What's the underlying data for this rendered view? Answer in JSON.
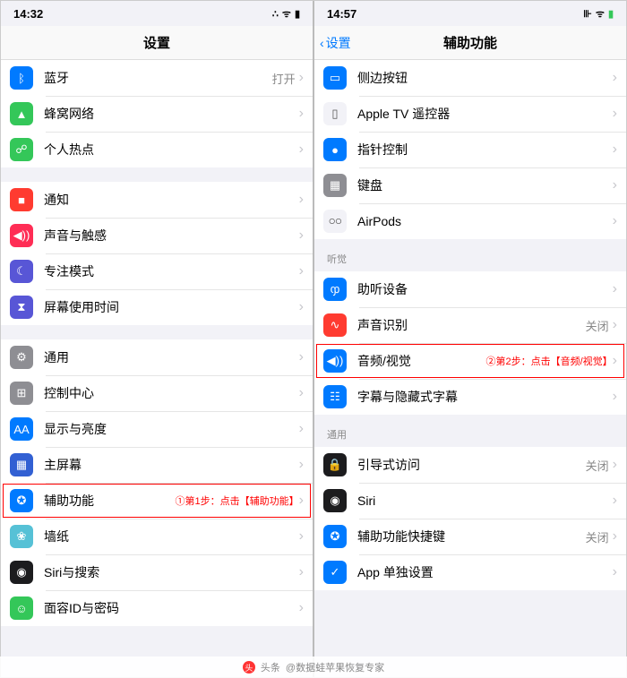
{
  "left": {
    "status": {
      "time": "14:32",
      "signal": "▪▪▪▪",
      "wifi": "✓",
      "battery": "■"
    },
    "title": "设置",
    "groups": [
      {
        "rows": [
          {
            "icon": "bluetooth",
            "bg": "#007aff",
            "label": "蓝牙",
            "value": "打开"
          },
          {
            "icon": "cellular",
            "bg": "#34c759",
            "label": "蜂窝网络",
            "value": ""
          },
          {
            "icon": "hotspot",
            "bg": "#34c759",
            "label": "个人热点",
            "value": ""
          }
        ]
      },
      {
        "rows": [
          {
            "icon": "notify",
            "bg": "#ff3b30",
            "label": "通知",
            "value": ""
          },
          {
            "icon": "sound",
            "bg": "#ff2d55",
            "label": "声音与触感",
            "value": ""
          },
          {
            "icon": "focus",
            "bg": "#5856d6",
            "label": "专注模式",
            "value": ""
          },
          {
            "icon": "screentime",
            "bg": "#5856d6",
            "label": "屏幕使用时间",
            "value": ""
          }
        ]
      },
      {
        "rows": [
          {
            "icon": "general",
            "bg": "#8e8e93",
            "label": "通用",
            "value": ""
          },
          {
            "icon": "control",
            "bg": "#8e8e93",
            "label": "控制中心",
            "value": ""
          },
          {
            "icon": "display",
            "bg": "#007aff",
            "label": "显示与亮度",
            "value": ""
          },
          {
            "icon": "home",
            "bg": "#3260d3",
            "label": "主屏幕",
            "value": ""
          },
          {
            "icon": "access",
            "bg": "#007aff",
            "label": "辅助功能",
            "value": "",
            "highlight": true,
            "annotation": "①第1步：点击【辅助功能】"
          },
          {
            "icon": "wallpaper",
            "bg": "#56c1d6",
            "label": "墙纸",
            "value": ""
          },
          {
            "icon": "siri",
            "bg": "#1c1c1e",
            "label": "Siri与搜索",
            "value": ""
          },
          {
            "icon": "faceid",
            "bg": "#34c759",
            "label": "面容ID与密码",
            "value": ""
          }
        ]
      }
    ]
  },
  "right": {
    "status": {
      "time": "14:57",
      "signal": "▪▪",
      "wifi": "✓",
      "battery": "⚡"
    },
    "back": "设置",
    "title": "辅助功能",
    "groups": [
      {
        "rows": [
          {
            "icon": "sidebtn",
            "bg": "#007aff",
            "label": "侧边按钮",
            "value": ""
          },
          {
            "icon": "appletv",
            "bg": "#f2f2f7",
            "label": "Apple TV 遥控器",
            "value": ""
          },
          {
            "icon": "pointer",
            "bg": "#007aff",
            "label": "指针控制",
            "value": ""
          },
          {
            "icon": "keyboard",
            "bg": "#8e8e93",
            "label": "键盘",
            "value": ""
          },
          {
            "icon": "airpods",
            "bg": "#f2f2f7",
            "label": "AirPods",
            "value": ""
          }
        ]
      },
      {
        "header": "听觉",
        "rows": [
          {
            "icon": "hearing",
            "bg": "#007aff",
            "label": "助听设备",
            "value": ""
          },
          {
            "icon": "soundrec",
            "bg": "#ff3b30",
            "label": "声音识别",
            "value": "关闭"
          },
          {
            "icon": "av",
            "bg": "#007aff",
            "label": "音频/视觉",
            "value": "",
            "highlight": true,
            "annotation": "②第2步：点击【音频/视觉】"
          },
          {
            "icon": "subtitle",
            "bg": "#007aff",
            "label": "字幕与隐藏式字幕",
            "value": ""
          }
        ]
      },
      {
        "header": "通用",
        "rows": [
          {
            "icon": "guided",
            "bg": "#1c1c1e",
            "label": "引导式访问",
            "value": "关闭"
          },
          {
            "icon": "siri2",
            "bg": "#1c1c1e",
            "label": "Siri",
            "value": ""
          },
          {
            "icon": "shortcut",
            "bg": "#007aff",
            "label": "辅助功能快捷键",
            "value": "关闭"
          },
          {
            "icon": "perapp",
            "bg": "#007aff",
            "label": "App 单独设置",
            "value": ""
          }
        ]
      }
    ]
  },
  "footer": {
    "prefix": "头条",
    "text": "@数据蛙苹果恢复专家"
  }
}
